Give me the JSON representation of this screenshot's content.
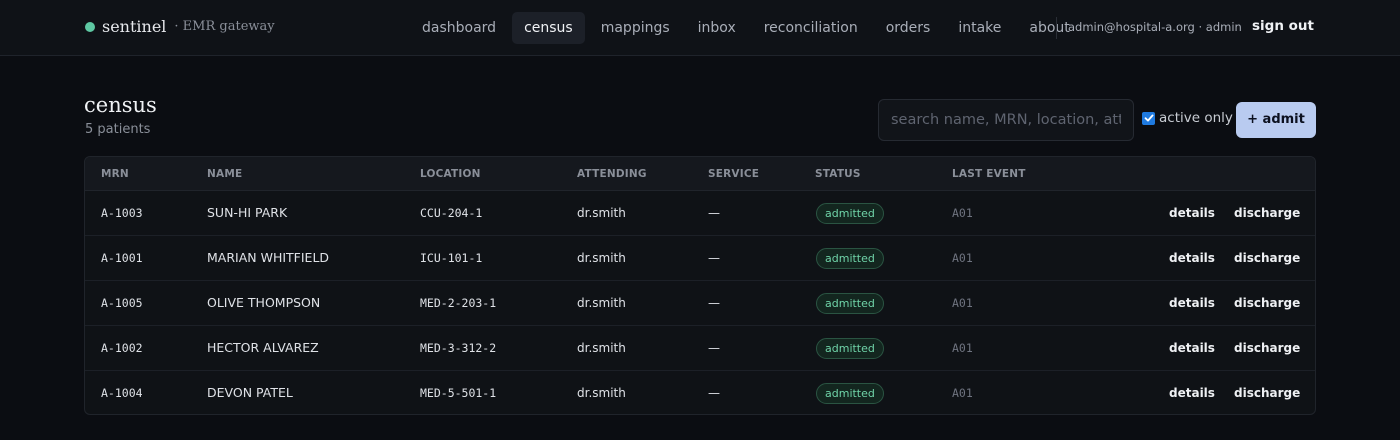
{
  "brand": {
    "name": "sentinel",
    "subtitle": "· EMR gateway",
    "accent": "#5ec8a3"
  },
  "nav": [
    {
      "label": "dashboard",
      "active": false
    },
    {
      "label": "census",
      "active": true
    },
    {
      "label": "mappings",
      "active": false
    },
    {
      "label": "inbox",
      "active": false
    },
    {
      "label": "reconciliation",
      "active": false
    },
    {
      "label": "orders",
      "active": false
    },
    {
      "label": "intake",
      "active": false
    },
    {
      "label": "about",
      "active": false
    }
  ],
  "user": {
    "text": "admin@hospital-a.org · admin",
    "signout": "sign out"
  },
  "page": {
    "title": "census",
    "count": "5 patients"
  },
  "controls": {
    "search_placeholder": "search name, MRN, location, attending",
    "search_value": "",
    "active_only_label": "active only",
    "active_only_checked": true,
    "admit_label": "+ admit"
  },
  "table": {
    "columns": [
      "MRN",
      "NAME",
      "LOCATION",
      "ATTENDING",
      "SERVICE",
      "STATUS",
      "LAST EVENT"
    ],
    "rows": [
      {
        "mrn": "A-1003",
        "name": "SUN-HI PARK",
        "location": "CCU-204-1",
        "attending": "dr.smith",
        "service": "—",
        "status": "admitted",
        "last_event": "A01"
      },
      {
        "mrn": "A-1001",
        "name": "MARIAN WHITFIELD",
        "location": "ICU-101-1",
        "attending": "dr.smith",
        "service": "—",
        "status": "admitted",
        "last_event": "A01"
      },
      {
        "mrn": "A-1005",
        "name": "OLIVE THOMPSON",
        "location": "MED-2-203-1",
        "attending": "dr.smith",
        "service": "—",
        "status": "admitted",
        "last_event": "A01"
      },
      {
        "mrn": "A-1002",
        "name": "HECTOR ALVAREZ",
        "location": "MED-3-312-2",
        "attending": "dr.smith",
        "service": "—",
        "status": "admitted",
        "last_event": "A01"
      },
      {
        "mrn": "A-1004",
        "name": "DEVON PATEL",
        "location": "MED-5-501-1",
        "attending": "dr.smith",
        "service": "—",
        "status": "admitted",
        "last_event": "A01"
      }
    ],
    "actions": {
      "details": "details",
      "discharge": "discharge"
    }
  }
}
